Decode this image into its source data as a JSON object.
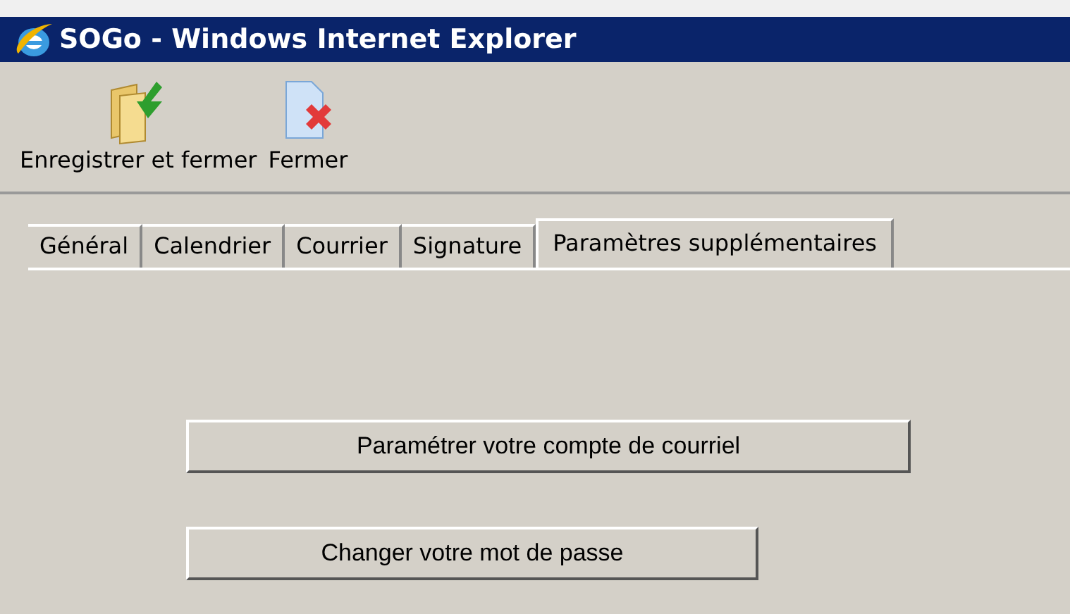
{
  "window": {
    "title": "SOGo - Windows Internet Explorer"
  },
  "toolbar": [
    {
      "kind": "save",
      "label": "Enregistrer et fermer"
    },
    {
      "kind": "close",
      "label": "Fermer"
    }
  ],
  "tabs": [
    {
      "label": "Général",
      "selected": false
    },
    {
      "label": "Calendrier",
      "selected": false
    },
    {
      "label": "Courrier",
      "selected": false
    },
    {
      "label": "Signature",
      "selected": false
    },
    {
      "label": "Paramètres supplémentaires",
      "selected": true
    }
  ],
  "buttons": [
    "Paramétrer votre compte de courriel",
    "Changer votre mot de passe"
  ]
}
